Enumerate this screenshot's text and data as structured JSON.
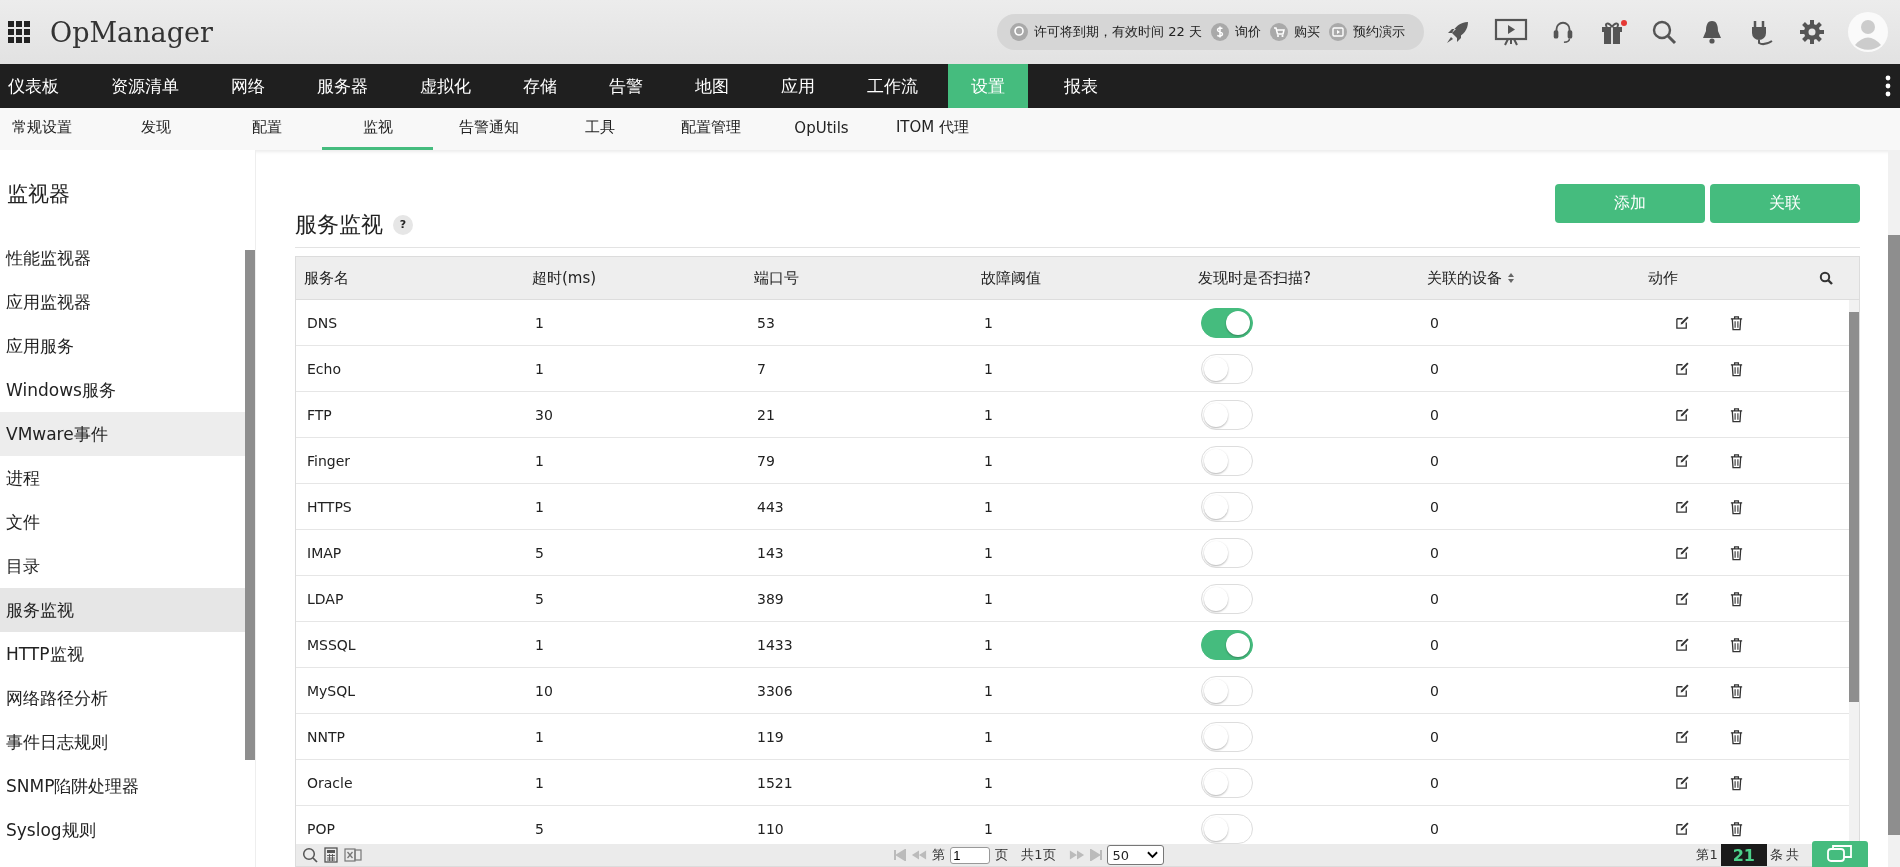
{
  "app": {
    "name": "OpManager"
  },
  "license_bar": {
    "notice": "许可将到期，有效时间 22 天",
    "links": [
      {
        "label": "询价",
        "kind": "price"
      },
      {
        "label": "购买",
        "kind": "cart"
      },
      {
        "label": "预约演示",
        "kind": "demo"
      }
    ]
  },
  "main_nav": [
    {
      "label": "仪表板",
      "selected": false
    },
    {
      "label": "资源清单",
      "selected": false
    },
    {
      "label": "网络",
      "selected": false
    },
    {
      "label": "服务器",
      "selected": false
    },
    {
      "label": "虚拟化",
      "selected": false
    },
    {
      "label": "存储",
      "selected": false
    },
    {
      "label": "告警",
      "selected": false
    },
    {
      "label": "地图",
      "selected": false
    },
    {
      "label": "应用",
      "selected": false
    },
    {
      "label": "工作流",
      "selected": false
    },
    {
      "label": "设置",
      "selected": true
    },
    {
      "label": "报表",
      "selected": false
    }
  ],
  "sub_nav": [
    {
      "label": "常规设置",
      "selected": false
    },
    {
      "label": "发现",
      "selected": false
    },
    {
      "label": "配置",
      "selected": false
    },
    {
      "label": "监视",
      "selected": true
    },
    {
      "label": "告警通知",
      "selected": false
    },
    {
      "label": "工具",
      "selected": false
    },
    {
      "label": "配置管理",
      "selected": false
    },
    {
      "label": "OpUtils",
      "selected": false
    },
    {
      "label": "ITOM 代理",
      "selected": false
    }
  ],
  "sidebar": {
    "title": "监视器",
    "items": [
      {
        "label": "性能监视器",
        "selected": false,
        "highlighted": false
      },
      {
        "label": "应用监视器",
        "selected": false,
        "highlighted": false
      },
      {
        "label": "应用服务",
        "selected": false,
        "highlighted": false
      },
      {
        "label": "Windows服务",
        "selected": false,
        "highlighted": false
      },
      {
        "label": "VMware事件",
        "selected": false,
        "highlighted": true
      },
      {
        "label": "进程",
        "selected": false,
        "highlighted": false
      },
      {
        "label": "文件",
        "selected": false,
        "highlighted": false
      },
      {
        "label": "目录",
        "selected": false,
        "highlighted": false
      },
      {
        "label": "服务监视",
        "selected": true,
        "highlighted": false
      },
      {
        "label": "HTTP监视",
        "selected": false,
        "highlighted": false
      },
      {
        "label": "网络路径分析",
        "selected": false,
        "highlighted": false
      },
      {
        "label": "事件日志规则",
        "selected": false,
        "highlighted": false
      },
      {
        "label": "SNMP陷阱处理器",
        "selected": false,
        "highlighted": false
      },
      {
        "label": "Syslog规则",
        "selected": false,
        "highlighted": false
      }
    ]
  },
  "page": {
    "title": "服务监视",
    "help": "?",
    "buttons": [
      "添加",
      "关联"
    ]
  },
  "table": {
    "columns": [
      {
        "label": "服务名",
        "sortable": false
      },
      {
        "label": "超时(ms)",
        "sortable": false
      },
      {
        "label": "端口号",
        "sortable": false
      },
      {
        "label": "故障阈值",
        "sortable": false
      },
      {
        "label": "发现时是否扫描?",
        "sortable": false
      },
      {
        "label": "关联的设备",
        "sortable": true
      },
      {
        "label": "动作",
        "sortable": false
      }
    ],
    "rows": [
      {
        "name": "DNS",
        "timeout": "1",
        "port": "53",
        "threshold": "1",
        "scan": true,
        "devices": "0"
      },
      {
        "name": "Echo",
        "timeout": "1",
        "port": "7",
        "threshold": "1",
        "scan": false,
        "devices": "0"
      },
      {
        "name": "FTP",
        "timeout": "30",
        "port": "21",
        "threshold": "1",
        "scan": false,
        "devices": "0"
      },
      {
        "name": "Finger",
        "timeout": "1",
        "port": "79",
        "threshold": "1",
        "scan": false,
        "devices": "0"
      },
      {
        "name": "HTTPS",
        "timeout": "1",
        "port": "443",
        "threshold": "1",
        "scan": false,
        "devices": "0"
      },
      {
        "name": "IMAP",
        "timeout": "5",
        "port": "143",
        "threshold": "1",
        "scan": false,
        "devices": "0"
      },
      {
        "name": "LDAP",
        "timeout": "5",
        "port": "389",
        "threshold": "1",
        "scan": false,
        "devices": "0"
      },
      {
        "name": "MSSQL",
        "timeout": "1",
        "port": "1433",
        "threshold": "1",
        "scan": true,
        "devices": "0"
      },
      {
        "name": "MySQL",
        "timeout": "10",
        "port": "3306",
        "threshold": "1",
        "scan": false,
        "devices": "0"
      },
      {
        "name": "NNTP",
        "timeout": "1",
        "port": "119",
        "threshold": "1",
        "scan": false,
        "devices": "0"
      },
      {
        "name": "Oracle",
        "timeout": "1",
        "port": "1521",
        "threshold": "1",
        "scan": false,
        "devices": "0"
      },
      {
        "name": "POP",
        "timeout": "5",
        "port": "110",
        "threshold": "1",
        "scan": false,
        "devices": "0"
      }
    ]
  },
  "pager": {
    "page_prefix": "第",
    "page": "1",
    "page_suffix": "页",
    "total": "共1页",
    "page_size": "50",
    "records_prefix": "第1",
    "records_unit": "条",
    "records_total": "共",
    "badge": "21"
  }
}
